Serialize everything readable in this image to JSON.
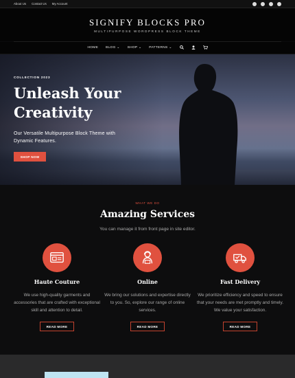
{
  "topbar": {
    "links": [
      "About Us",
      "Contact Us",
      "My Account"
    ],
    "social_icons": [
      "facebook-icon",
      "twitter-icon",
      "linkedin-icon",
      "pinterest-icon"
    ]
  },
  "header": {
    "brand": "SIGNIFY BLOCKS PRO",
    "tagline": "MULTIPURPOSE WORDPRESS BLOCK THEME"
  },
  "nav": {
    "items": [
      {
        "label": "HOME"
      },
      {
        "label": "BLOG",
        "caret": "⌄"
      },
      {
        "label": "SHOP",
        "caret": "⌄"
      },
      {
        "label": "PATTERNS",
        "caret": "⌄"
      }
    ],
    "icons": [
      "search-icon",
      "user-icon",
      "cart-icon"
    ]
  },
  "hero": {
    "kicker": "COLLECTION 2023",
    "title_line1": "Unleash Your",
    "title_line2": "Creativity",
    "subtitle": "Our Versatile Multipurpose Block Theme with Dynamic Features.",
    "button": "SHOP NOW"
  },
  "services": {
    "kicker": "WHAT WE DO",
    "title": "Amazing Services",
    "desc": "You can manage it from front page in site editor.",
    "cards": [
      {
        "icon": "web-browser-icon",
        "title": "Haute Couture",
        "text": "We use high-quality garments and accessories that are crafted with exceptional skill and attention to detail.",
        "button": "READ MORE"
      },
      {
        "icon": "online-support-icon",
        "title": "Online",
        "text": "We bring our solutions and expertise directly to you. So, explore our range of online services.",
        "button": "READ MORE"
      },
      {
        "icon": "delivery-truck-icon",
        "title": "Fast Delivery",
        "text": "We prioritize efficiency and speed to ensure that your needs are met promptly and timely. We value your satisfaction.",
        "button": "READ MORE"
      }
    ]
  },
  "colors": {
    "accent": "#e0513f",
    "background": "#0d0d0e"
  }
}
